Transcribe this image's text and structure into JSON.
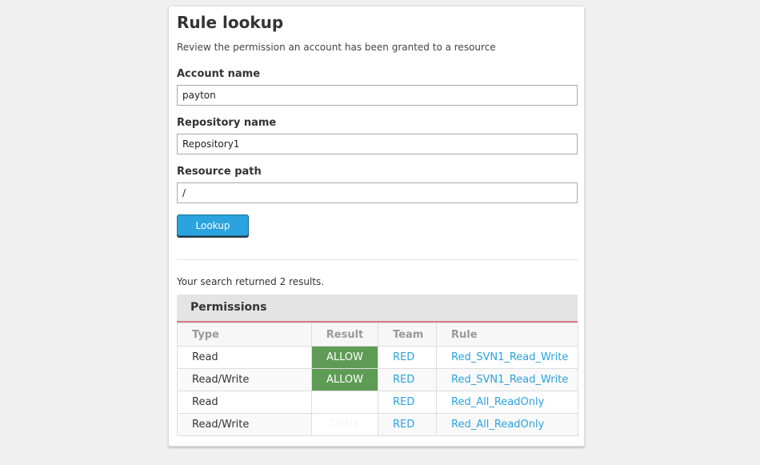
{
  "page": {
    "title": "Rule lookup",
    "subtitle": "Review the permission an account has been granted to a resource"
  },
  "form": {
    "account": {
      "label": "Account name",
      "value": "payton"
    },
    "repository": {
      "label": "Repository name",
      "value": "Repository1"
    },
    "path": {
      "label": "Resource path",
      "value": "/"
    },
    "lookup_label": "Lookup"
  },
  "results": {
    "summary": "Your search returned 2 results.",
    "panel_title": "Permissions",
    "columns": [
      "Type",
      "Result",
      "Team",
      "Rule"
    ],
    "rows": [
      {
        "type": "Read",
        "result": "ALLOW",
        "team": "RED",
        "rule": "Red_SVN1_Read_Write"
      },
      {
        "type": "Read/Write",
        "result": "ALLOW",
        "team": "RED",
        "rule": "Red_SVN1_Read_Write"
      },
      {
        "type": "Read",
        "result": "",
        "team": "RED",
        "rule": "Red_All_ReadOnly"
      },
      {
        "type": "Read/Write",
        "result": "DENY",
        "team": "RED",
        "rule": "Red_All_ReadOnly"
      }
    ]
  },
  "colors": {
    "accent": "#2aa3de",
    "allow": "#5e9c55",
    "panel_rule": "#d57a8e"
  }
}
